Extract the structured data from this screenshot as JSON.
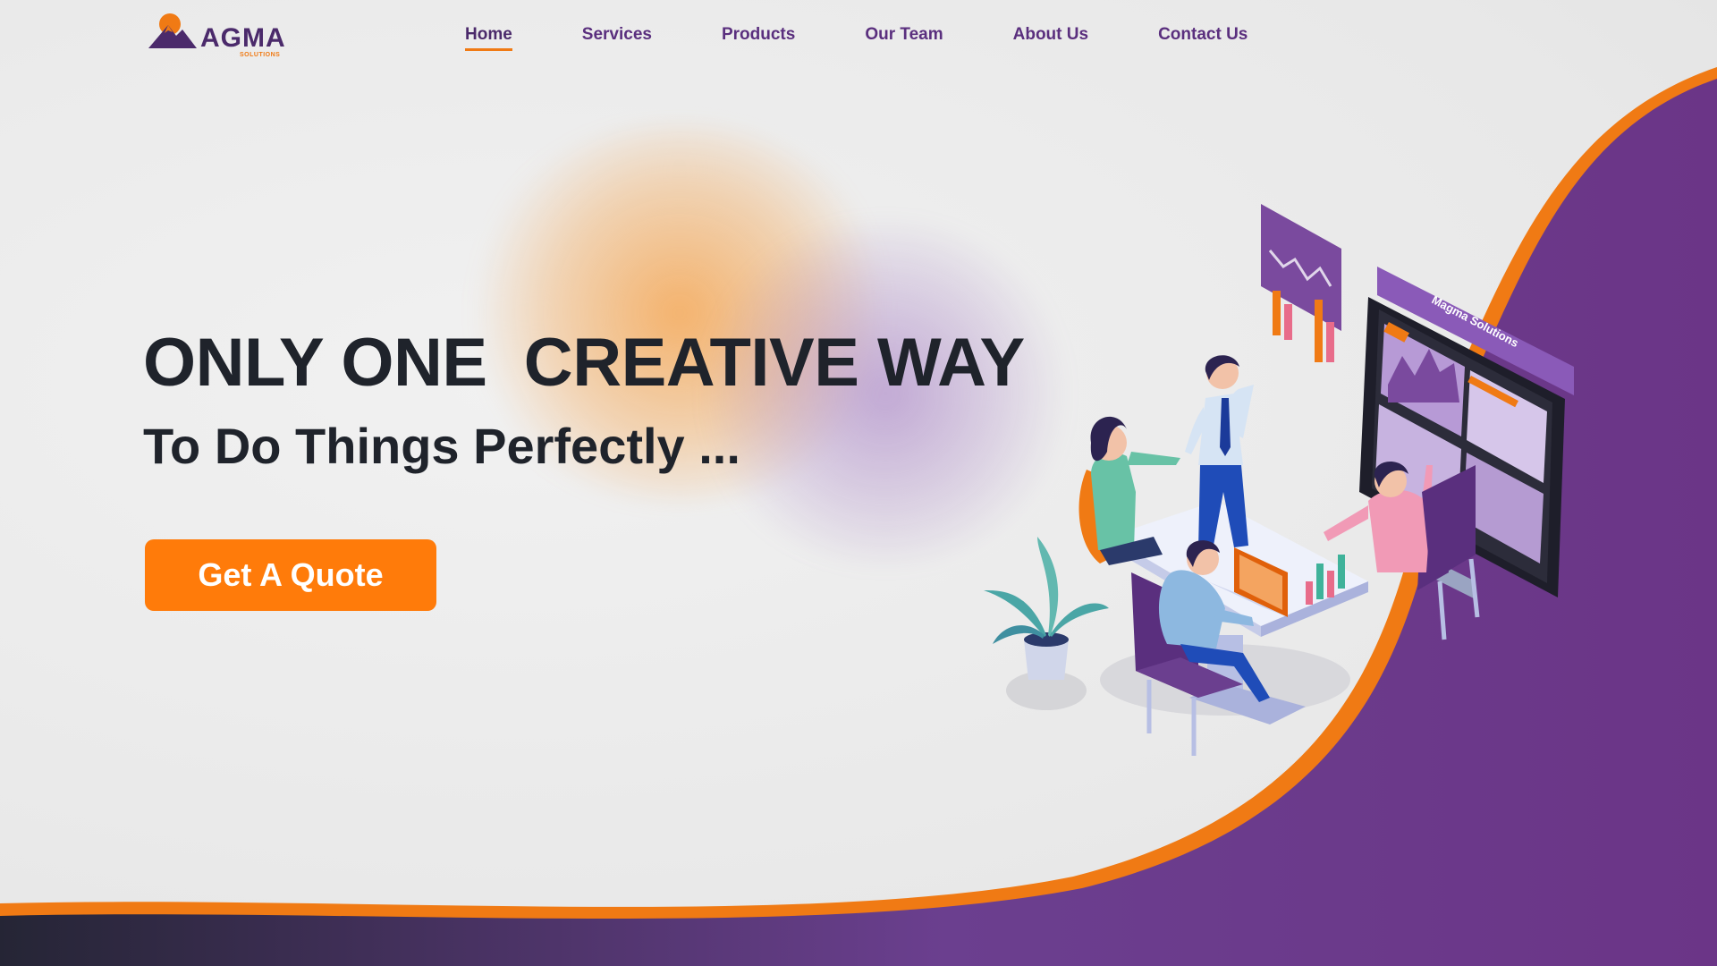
{
  "brand": {
    "name": "AGMA",
    "sub": "SOLUTIONS",
    "logo_icon": "mountain-sun-icon"
  },
  "nav": {
    "items": [
      {
        "label": "Home",
        "active": true
      },
      {
        "label": "Services",
        "active": false
      },
      {
        "label": "Products",
        "active": false
      },
      {
        "label": "Our Team",
        "active": false
      },
      {
        "label": "About Us",
        "active": false
      },
      {
        "label": "Contact Us",
        "active": false
      }
    ]
  },
  "hero": {
    "headline": "ONLY ONE  CREATIVE WAY",
    "subline": "To Do Things Perfectly ...",
    "cta_label": "Get A Quote"
  },
  "illustration": {
    "screen_label": "Magma Solutions"
  },
  "colors": {
    "accent": "#ff7b0a",
    "brand_purple": "#6b3587",
    "text_dark": "#1f232b",
    "nav_text": "#5a2f7e"
  }
}
